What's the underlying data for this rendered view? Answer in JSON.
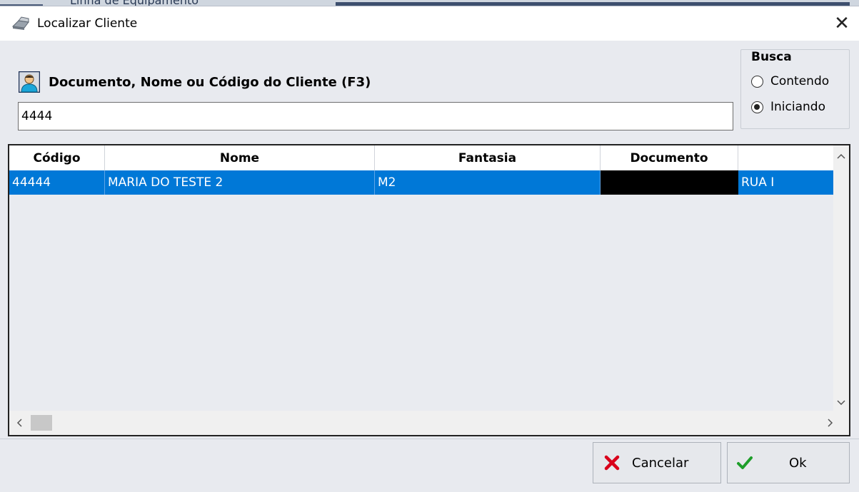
{
  "background": {
    "behind_text": "Linha de Equipamento"
  },
  "window": {
    "title": "Localizar Cliente",
    "close_glyph": "✕"
  },
  "search": {
    "label": "Documento, Nome ou Código do Cliente (F3)",
    "value": "4444"
  },
  "busca": {
    "title": "Busca",
    "options": [
      {
        "label": "Contendo",
        "checked": false
      },
      {
        "label": "Iniciando",
        "checked": true
      }
    ]
  },
  "grid": {
    "columns": [
      "Código",
      "Nome",
      "Fantasia",
      "Documento",
      ""
    ],
    "rows": [
      {
        "codigo": "44444",
        "nome": "MARIA DO TESTE 2",
        "fantasia": "M2",
        "documento": "",
        "endereco": "RUA I"
      }
    ]
  },
  "buttons": {
    "cancel_label": "Cancelar",
    "ok_label": "Ok"
  },
  "colors": {
    "selection": "#0078d7",
    "cancel_icon": "#d9001b",
    "ok_icon": "#1e9e2a"
  },
  "icons": {
    "title": "printer-icon",
    "search": "person-icon",
    "cancel": "x-icon",
    "ok": "check-icon"
  }
}
